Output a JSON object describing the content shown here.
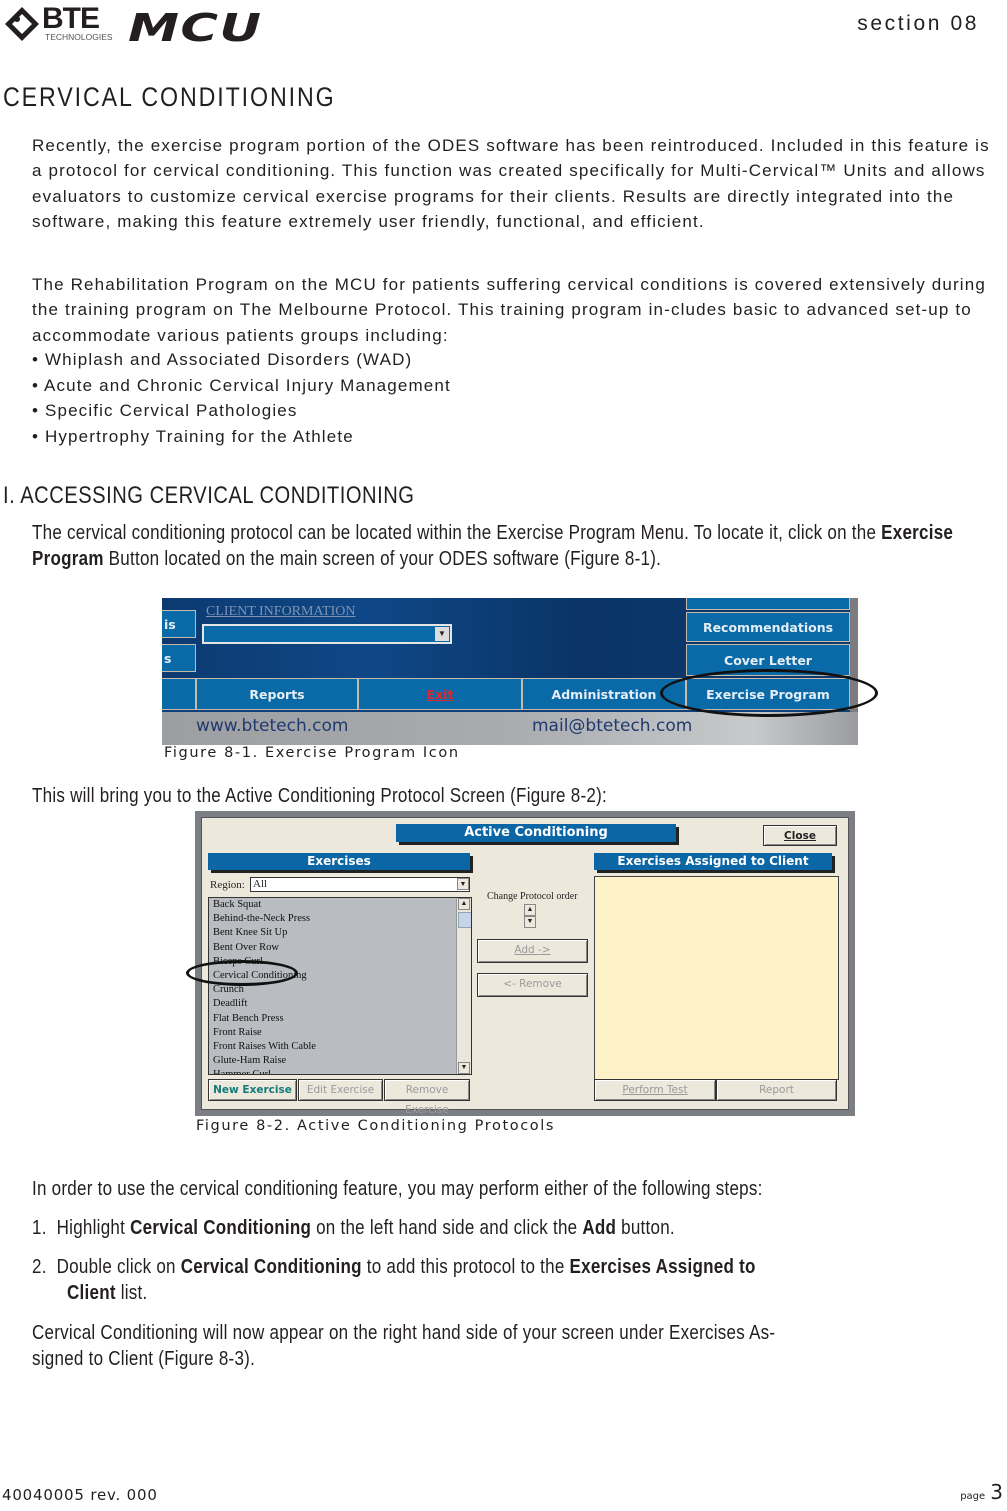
{
  "header": {
    "logo_bte": "BTE",
    "logo_bte_sub": "TECHNOLOGIES",
    "logo_mcu": "MCU",
    "section_label": "section 08"
  },
  "title": "CERVICAL CONDITIONING",
  "intro_paragraphs": [
    "Recently, the exercise program portion of the ODES software has been reintroduced. Included in this feature is a protocol for cervical conditioning. This function was created specifically for Multi-Cervical™ Units and allows evaluators to customize cervical exercise programs for their clients. Results are directly integrated into the software, making this feature extremely user friendly, functional, and efficient.",
    "The Rehabilitation Program on the MCU for patients suffering cervical conditions is covered extensively during the training program on The Melbourne Protocol. This training program in-cludes basic to advanced set-up to accommodate various patients groups including:"
  ],
  "bullets": [
    "Whiplash and Associated Disorders (WAD)",
    "Acute and Chronic Cervical Injury Management",
    "Specific Cervical Pathologies",
    "Hypertrophy Training for the Athlete"
  ],
  "section1": {
    "heading": "I. ACCESSING CERVICAL CONDITIONING",
    "para_parts": [
      "The cervical conditioning protocol can be located within the Exercise Program Menu. To locate it, click on the ",
      "Exercise Program",
      " Button located on the main screen of your ODES software (Figure 8-1)."
    ],
    "lead_in_fig2": "This will bring you to the Active Conditioning Protocol Screen (Figure 8-2):",
    "steps_intro": "In order to use the cervical conditioning feature, you may perform either of the following steps:",
    "step1": {
      "num": "1.",
      "parts": [
        "Highlight ",
        "Cervical Conditioning",
        " on the left hand side and click the ",
        "Add",
        " button."
      ]
    },
    "step2": {
      "num": "2.",
      "parts": [
        "Double click on ",
        "Cervical Conditioning",
        " to add this protocol to the ",
        "Exercises Assigned to",
        "Client",
        " list."
      ]
    },
    "conclusion": [
      "Cervical Conditioning will now appear on the right hand side of your screen under Exercises As-",
      "signed to Client (Figure 8-3)."
    ]
  },
  "figure1": {
    "caption": "Figure 8-1. Exercise Program Icon",
    "client_info_label": "CLIENT INFORMATION",
    "left_partial_buttons": [
      "is",
      "s"
    ],
    "right_buttons": [
      "Recommendations",
      "Cover Letter",
      "Exercise Program"
    ],
    "bottom_buttons": [
      "Reports",
      "Exit",
      "Administration"
    ],
    "website": "www.btetech.com",
    "email": "mail@btetech.com"
  },
  "figure2": {
    "caption": "Figure 8-2. Active Conditioning Protocols",
    "window_title": "Active Conditioning",
    "close_button": "Close",
    "exercises_header": "Exercises",
    "region_label": "Region:",
    "region_value": "All",
    "exercise_list": [
      "Back Squat",
      "Behind-the-Neck Press",
      "Bent Knee Sit Up",
      "Bent Over Row",
      "Biceps Curl",
      "Cervical Conditioning",
      "Crunch",
      "Deadlift",
      "Flat  Bench Press",
      "Front Raise",
      "Front Raises With Cable",
      "Glute-Ham Raise",
      "Hammer Curl"
    ],
    "change_order_label": "Change Protocol order",
    "add_button": "Add ->",
    "remove_button": "<- Remove",
    "assigned_header": "Exercises Assigned to Client",
    "new_exercise_button": "New Exercise",
    "edit_exercise_button": "Edit Exercise",
    "remove_exercise_button": "Remove Exercise",
    "perform_test_button": "Perform Test",
    "report_button": "Report"
  },
  "footer": {
    "doc_number": "40040005 rev. 000",
    "page_label": "page",
    "page_number": "3"
  }
}
